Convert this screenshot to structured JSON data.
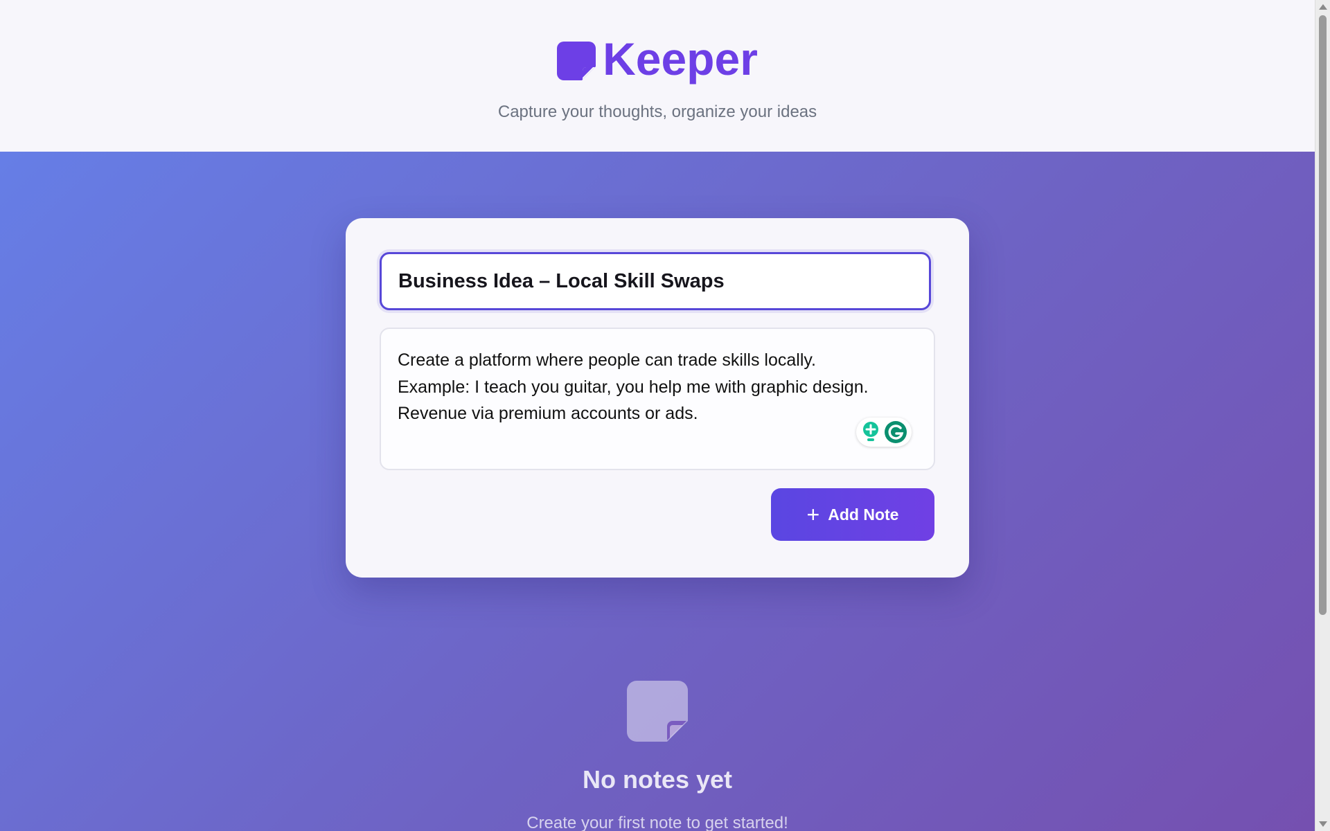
{
  "header": {
    "app_name": "Keeper",
    "tagline": "Capture your thoughts, organize your ideas",
    "logo_icon": "note-icon"
  },
  "note_form": {
    "title_value": "Business Idea – Local Skill Swaps",
    "body_lines": [
      "Create a platform where people can trade skills locally.",
      "Example: I teach you guitar, you help me with graphic design.",
      "Revenue via premium accounts or ads."
    ],
    "add_button_label": "Add Note",
    "add_button_icon": "plus-icon",
    "assistant_icons": [
      "lightbulb-icon",
      "grammarly-icon"
    ]
  },
  "empty_state": {
    "icon": "note-icon",
    "title": "No notes yet",
    "subtitle": "Create your first note to get started!"
  },
  "colors": {
    "brand": "#6d3fe6",
    "accent": "#5a46e2",
    "grammarly": "#15c39a"
  }
}
